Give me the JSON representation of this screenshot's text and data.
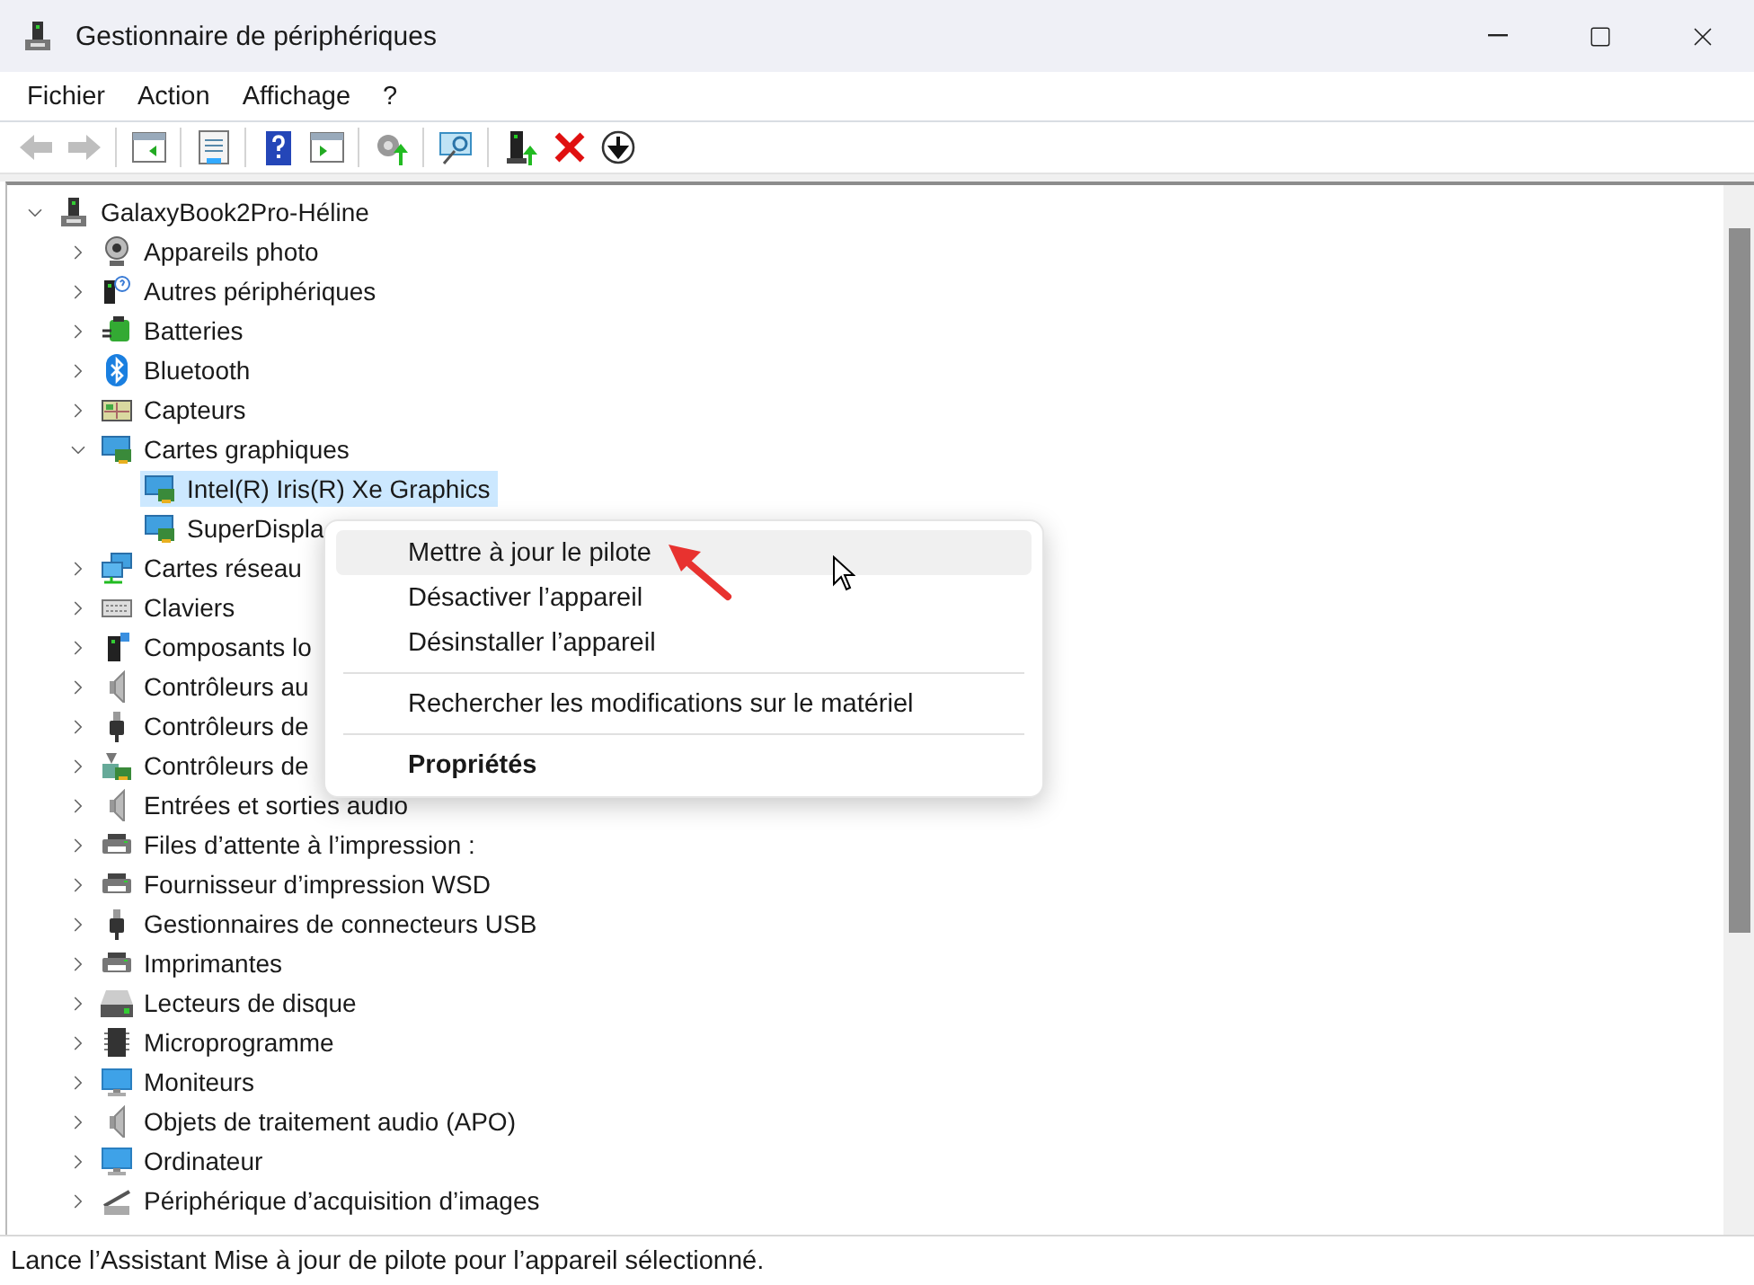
{
  "window": {
    "title": "Gestionnaire de périphériques"
  },
  "menu_bar": [
    "Fichier",
    "Action",
    "Affichage",
    "?"
  ],
  "toolbar": [
    {
      "kind": "back",
      "disabled": true
    },
    {
      "kind": "forward",
      "disabled": true
    },
    {
      "kind": "separator"
    },
    {
      "kind": "console-tree",
      "disabled": false
    },
    {
      "kind": "separator"
    },
    {
      "kind": "properties",
      "disabled": false
    },
    {
      "kind": "separator"
    },
    {
      "kind": "help",
      "disabled": false
    },
    {
      "kind": "action-pane",
      "disabled": false
    },
    {
      "kind": "separator"
    },
    {
      "kind": "update-driver",
      "disabled": false
    },
    {
      "kind": "separator"
    },
    {
      "kind": "scan",
      "disabled": false
    },
    {
      "kind": "separator"
    },
    {
      "kind": "enable",
      "disabled": false
    },
    {
      "kind": "uninstall",
      "disabled": false
    },
    {
      "kind": "disable",
      "disabled": false
    }
  ],
  "tree": {
    "label": "GalaxyBook2Pro-Héline",
    "kind": "tower",
    "expanded": true,
    "selected": false,
    "children": [
      {
        "label": "Appareils photo",
        "kind": "camera",
        "expanded": false,
        "selected": false
      },
      {
        "label": "Autres périphériques",
        "kind": "unknown",
        "expanded": false,
        "selected": false
      },
      {
        "label": "Batteries",
        "kind": "battery",
        "expanded": false,
        "selected": false
      },
      {
        "label": "Bluetooth",
        "kind": "bluetooth",
        "expanded": false,
        "selected": false
      },
      {
        "label": "Capteurs",
        "kind": "sensor",
        "expanded": false,
        "selected": false
      },
      {
        "label": "Cartes graphiques",
        "kind": "display",
        "expanded": true,
        "selected": false,
        "children": [
          {
            "label": "Intel(R) Iris(R) Xe Graphics",
            "kind": "display",
            "selected": true
          },
          {
            "label": "SuperDispla",
            "kind": "display",
            "selected": false
          }
        ]
      },
      {
        "label": "Cartes réseau",
        "kind": "network",
        "expanded": false,
        "selected": false
      },
      {
        "label": "Claviers",
        "kind": "keyboard",
        "expanded": false,
        "selected": false
      },
      {
        "label": "Composants lo",
        "kind": "component",
        "expanded": false,
        "selected": false
      },
      {
        "label": "Contrôleurs au",
        "kind": "speaker",
        "expanded": false,
        "selected": false
      },
      {
        "label": "Contrôleurs de",
        "kind": "usb",
        "expanded": false,
        "selected": false
      },
      {
        "label": "Contrôleurs de",
        "kind": "storage",
        "expanded": false,
        "selected": false
      },
      {
        "label": "Entrées et sorties audio",
        "kind": "speaker",
        "expanded": false,
        "selected": false
      },
      {
        "label": "Files d’attente à l’impression :",
        "kind": "printer",
        "expanded": false,
        "selected": false
      },
      {
        "label": "Fournisseur d’impression WSD",
        "kind": "printer",
        "expanded": false,
        "selected": false
      },
      {
        "label": "Gestionnaires de connecteurs USB",
        "kind": "usb",
        "expanded": false,
        "selected": false
      },
      {
        "label": "Imprimantes",
        "kind": "printer",
        "expanded": false,
        "selected": false
      },
      {
        "label": "Lecteurs de disque",
        "kind": "disk",
        "expanded": false,
        "selected": false
      },
      {
        "label": "Microprogramme",
        "kind": "chip",
        "expanded": false,
        "selected": false
      },
      {
        "label": "Moniteurs",
        "kind": "monitor",
        "expanded": false,
        "selected": false
      },
      {
        "label": "Objets de traitement audio (APO)",
        "kind": "speaker",
        "expanded": false,
        "selected": false
      },
      {
        "label": "Ordinateur",
        "kind": "monitor",
        "expanded": false,
        "selected": false
      },
      {
        "label": "Périphérique d’acquisition d’images",
        "kind": "scanner",
        "expanded": false,
        "selected": false
      }
    ]
  },
  "context_menu": [
    {
      "kind": "item",
      "label": "Mettre à jour le pilote",
      "selected": true,
      "default": false
    },
    {
      "kind": "item",
      "label": "Désactiver l’appareil",
      "selected": false,
      "default": false
    },
    {
      "kind": "item",
      "label": "Désinstaller l’appareil",
      "selected": false,
      "default": false
    },
    {
      "kind": "separator"
    },
    {
      "kind": "item",
      "label": "Rechercher les modifications sur le matériel",
      "selected": false,
      "default": false
    },
    {
      "kind": "separator"
    },
    {
      "kind": "item",
      "label": "Propriétés",
      "selected": false,
      "default": true
    }
  ],
  "status_bar": {
    "text": "Lance l’Assistant Mise à jour de pilote pour l’appareil sélectionné."
  }
}
